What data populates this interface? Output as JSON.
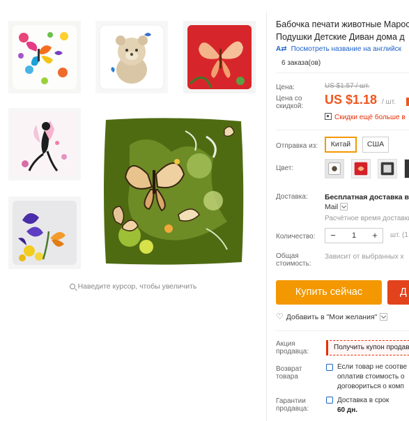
{
  "product": {
    "title_line1": "Бабочка печати животные Мароc",
    "title_line2": "Подушки Детские Диван дома д",
    "translate_icon": "A⇄",
    "translate_link": "Посмотреть название на английск",
    "orders": "6 заказа(ов)"
  },
  "gallery": {
    "zoom_hint": "Наведите курсор, чтобы увеличить",
    "zoom_icon": "magnifier-icon"
  },
  "price": {
    "label": "Цена:",
    "old": "US $1.57 / шт.",
    "discount_label_1": "Цена со",
    "discount_label_2": "скидкой:",
    "new": "US $1.18",
    "unit": "/ шт.",
    "bulk_text": "Скидки ещё больше в",
    "accent_color": "#f0551c"
  },
  "options": {
    "ship_from_label": "Отправка из:",
    "ship_from": [
      "Китай",
      "США"
    ],
    "ship_from_selected": "Китай",
    "color_label": "Цвет:"
  },
  "shipping": {
    "label": "Доставка:",
    "title": "Бесплатная доставка в",
    "method": "Mail",
    "estimate": "Расчётное время доставки"
  },
  "quantity": {
    "label": "Количество:",
    "minus": "−",
    "value": "1",
    "plus": "+",
    "unit": "шт. (1"
  },
  "total": {
    "label_1": "Общая",
    "label_2": "стоимость:",
    "value": "Зависит от выбранных х"
  },
  "actions": {
    "buy_now": "Купить сейчас",
    "add_to_cart": "Д",
    "wishlist": "Добавить в \"Мои желания\"",
    "buy_color": "#f39800",
    "cart_color": "#e2421c"
  },
  "seller": {
    "promo_label_1": "Акция",
    "promo_label_2": "продавца:",
    "coupon": "Получить купон продав",
    "return_label_1": "Возврат",
    "return_label_2": "товара",
    "return_line1": "Если товар не соотве",
    "return_line2": "оплатив стоимость о",
    "return_line3": "договориться о комп",
    "guarantee_label_1": "Гарантии",
    "guarantee_label_2": "продавца:",
    "guarantee_line1": "Доставка в срок",
    "guarantee_line2": "60 дн."
  }
}
